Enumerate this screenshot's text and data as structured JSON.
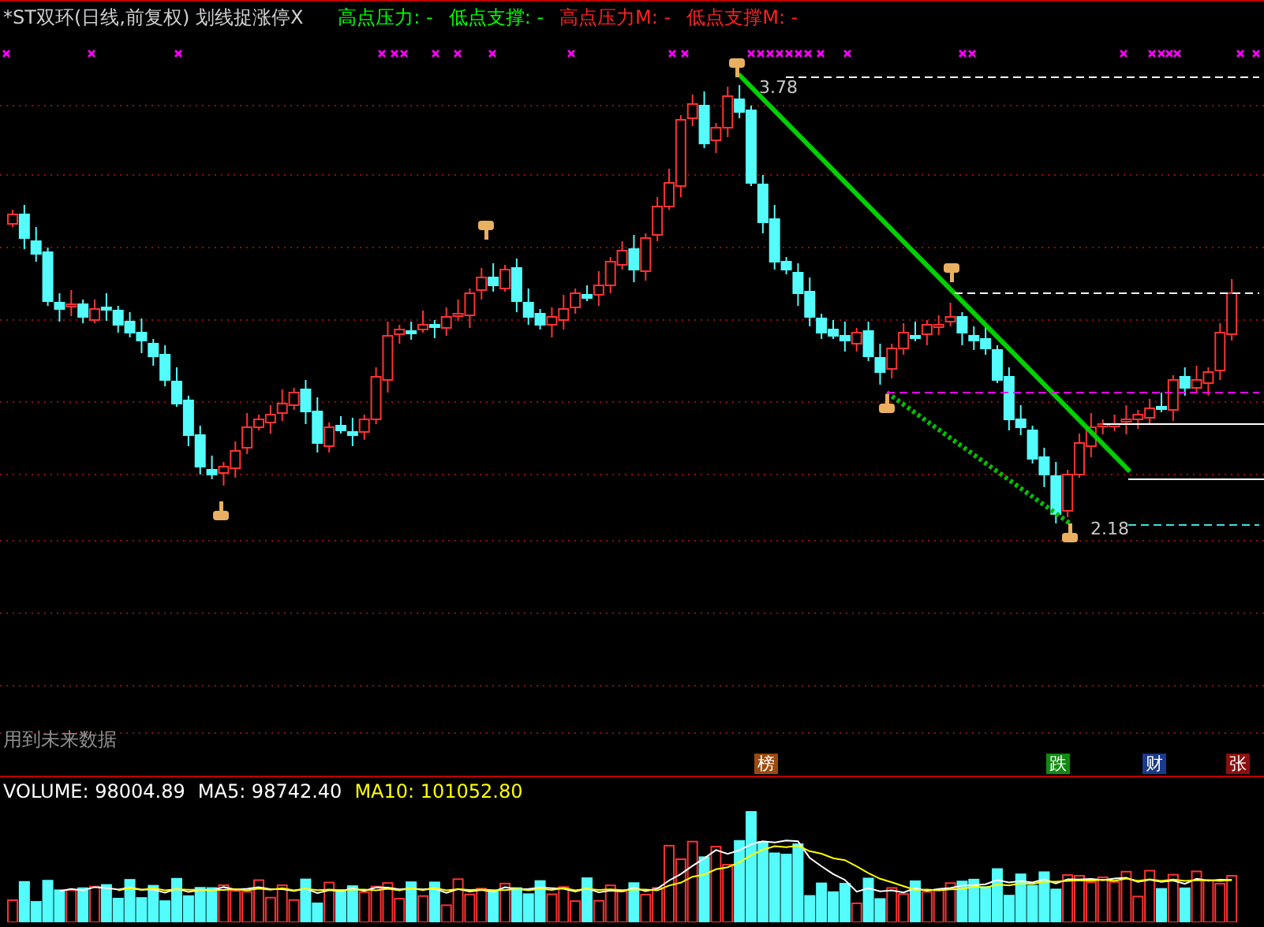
{
  "chart_header": {
    "title": "*ST双环(日线,前复权) 划线捉涨停X",
    "indicators": [
      {
        "text": "高点压力: -",
        "color": "#00ff00"
      },
      {
        "text": "低点支撑: -",
        "color": "#00ff00"
      },
      {
        "text": "高点压力M: -",
        "color": "#ff2020"
      },
      {
        "text": "低点支撑M: -",
        "color": "#ff2020"
      }
    ]
  },
  "price_labels": [
    {
      "kind": "high",
      "text": "3.78"
    },
    {
      "kind": "low",
      "text": "2.18"
    }
  ],
  "footer_note": "用到未来数据",
  "badges": [
    {
      "text": "榜",
      "color": "#9a4a10"
    },
    {
      "text": "跌",
      "color": "#128a12"
    },
    {
      "text": "财",
      "color": "#1a3a8a"
    },
    {
      "text": "张",
      "color": "#8a1010"
    }
  ],
  "volume_legend": [
    {
      "text": "VOLUME: 98004.89",
      "color": "#ffffff"
    },
    {
      "text": "MA5: 98742.40",
      "color": "#ffffff"
    },
    {
      "text": "MA10: 101052.80",
      "color": "#ffff00"
    }
  ]
}
